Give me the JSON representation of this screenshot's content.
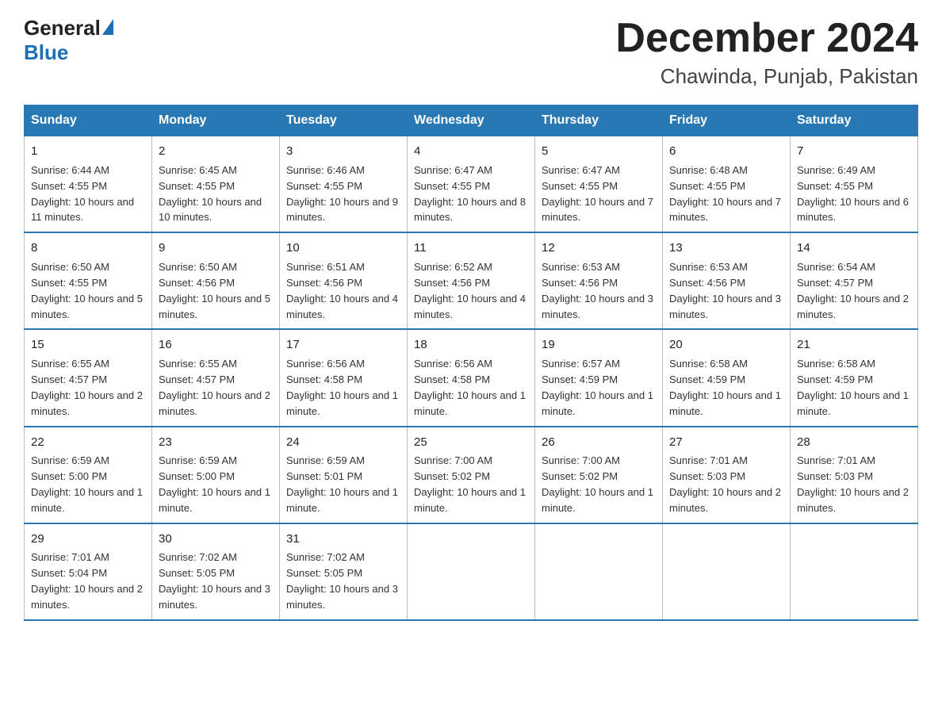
{
  "header": {
    "logo_general": "General",
    "logo_blue": "Blue",
    "month_title": "December 2024",
    "location": "Chawinda, Punjab, Pakistan"
  },
  "days_of_week": [
    "Sunday",
    "Monday",
    "Tuesday",
    "Wednesday",
    "Thursday",
    "Friday",
    "Saturday"
  ],
  "weeks": [
    [
      {
        "day": "1",
        "sunrise": "6:44 AM",
        "sunset": "4:55 PM",
        "daylight": "10 hours and 11 minutes."
      },
      {
        "day": "2",
        "sunrise": "6:45 AM",
        "sunset": "4:55 PM",
        "daylight": "10 hours and 10 minutes."
      },
      {
        "day": "3",
        "sunrise": "6:46 AM",
        "sunset": "4:55 PM",
        "daylight": "10 hours and 9 minutes."
      },
      {
        "day": "4",
        "sunrise": "6:47 AM",
        "sunset": "4:55 PM",
        "daylight": "10 hours and 8 minutes."
      },
      {
        "day": "5",
        "sunrise": "6:47 AM",
        "sunset": "4:55 PM",
        "daylight": "10 hours and 7 minutes."
      },
      {
        "day": "6",
        "sunrise": "6:48 AM",
        "sunset": "4:55 PM",
        "daylight": "10 hours and 7 minutes."
      },
      {
        "day": "7",
        "sunrise": "6:49 AM",
        "sunset": "4:55 PM",
        "daylight": "10 hours and 6 minutes."
      }
    ],
    [
      {
        "day": "8",
        "sunrise": "6:50 AM",
        "sunset": "4:55 PM",
        "daylight": "10 hours and 5 minutes."
      },
      {
        "day": "9",
        "sunrise": "6:50 AM",
        "sunset": "4:56 PM",
        "daylight": "10 hours and 5 minutes."
      },
      {
        "day": "10",
        "sunrise": "6:51 AM",
        "sunset": "4:56 PM",
        "daylight": "10 hours and 4 minutes."
      },
      {
        "day": "11",
        "sunrise": "6:52 AM",
        "sunset": "4:56 PM",
        "daylight": "10 hours and 4 minutes."
      },
      {
        "day": "12",
        "sunrise": "6:53 AM",
        "sunset": "4:56 PM",
        "daylight": "10 hours and 3 minutes."
      },
      {
        "day": "13",
        "sunrise": "6:53 AM",
        "sunset": "4:56 PM",
        "daylight": "10 hours and 3 minutes."
      },
      {
        "day": "14",
        "sunrise": "6:54 AM",
        "sunset": "4:57 PM",
        "daylight": "10 hours and 2 minutes."
      }
    ],
    [
      {
        "day": "15",
        "sunrise": "6:55 AM",
        "sunset": "4:57 PM",
        "daylight": "10 hours and 2 minutes."
      },
      {
        "day": "16",
        "sunrise": "6:55 AM",
        "sunset": "4:57 PM",
        "daylight": "10 hours and 2 minutes."
      },
      {
        "day": "17",
        "sunrise": "6:56 AM",
        "sunset": "4:58 PM",
        "daylight": "10 hours and 1 minute."
      },
      {
        "day": "18",
        "sunrise": "6:56 AM",
        "sunset": "4:58 PM",
        "daylight": "10 hours and 1 minute."
      },
      {
        "day": "19",
        "sunrise": "6:57 AM",
        "sunset": "4:59 PM",
        "daylight": "10 hours and 1 minute."
      },
      {
        "day": "20",
        "sunrise": "6:58 AM",
        "sunset": "4:59 PM",
        "daylight": "10 hours and 1 minute."
      },
      {
        "day": "21",
        "sunrise": "6:58 AM",
        "sunset": "4:59 PM",
        "daylight": "10 hours and 1 minute."
      }
    ],
    [
      {
        "day": "22",
        "sunrise": "6:59 AM",
        "sunset": "5:00 PM",
        "daylight": "10 hours and 1 minute."
      },
      {
        "day": "23",
        "sunrise": "6:59 AM",
        "sunset": "5:00 PM",
        "daylight": "10 hours and 1 minute."
      },
      {
        "day": "24",
        "sunrise": "6:59 AM",
        "sunset": "5:01 PM",
        "daylight": "10 hours and 1 minute."
      },
      {
        "day": "25",
        "sunrise": "7:00 AM",
        "sunset": "5:02 PM",
        "daylight": "10 hours and 1 minute."
      },
      {
        "day": "26",
        "sunrise": "7:00 AM",
        "sunset": "5:02 PM",
        "daylight": "10 hours and 1 minute."
      },
      {
        "day": "27",
        "sunrise": "7:01 AM",
        "sunset": "5:03 PM",
        "daylight": "10 hours and 2 minutes."
      },
      {
        "day": "28",
        "sunrise": "7:01 AM",
        "sunset": "5:03 PM",
        "daylight": "10 hours and 2 minutes."
      }
    ],
    [
      {
        "day": "29",
        "sunrise": "7:01 AM",
        "sunset": "5:04 PM",
        "daylight": "10 hours and 2 minutes."
      },
      {
        "day": "30",
        "sunrise": "7:02 AM",
        "sunset": "5:05 PM",
        "daylight": "10 hours and 3 minutes."
      },
      {
        "day": "31",
        "sunrise": "7:02 AM",
        "sunset": "5:05 PM",
        "daylight": "10 hours and 3 minutes."
      },
      null,
      null,
      null,
      null
    ]
  ]
}
